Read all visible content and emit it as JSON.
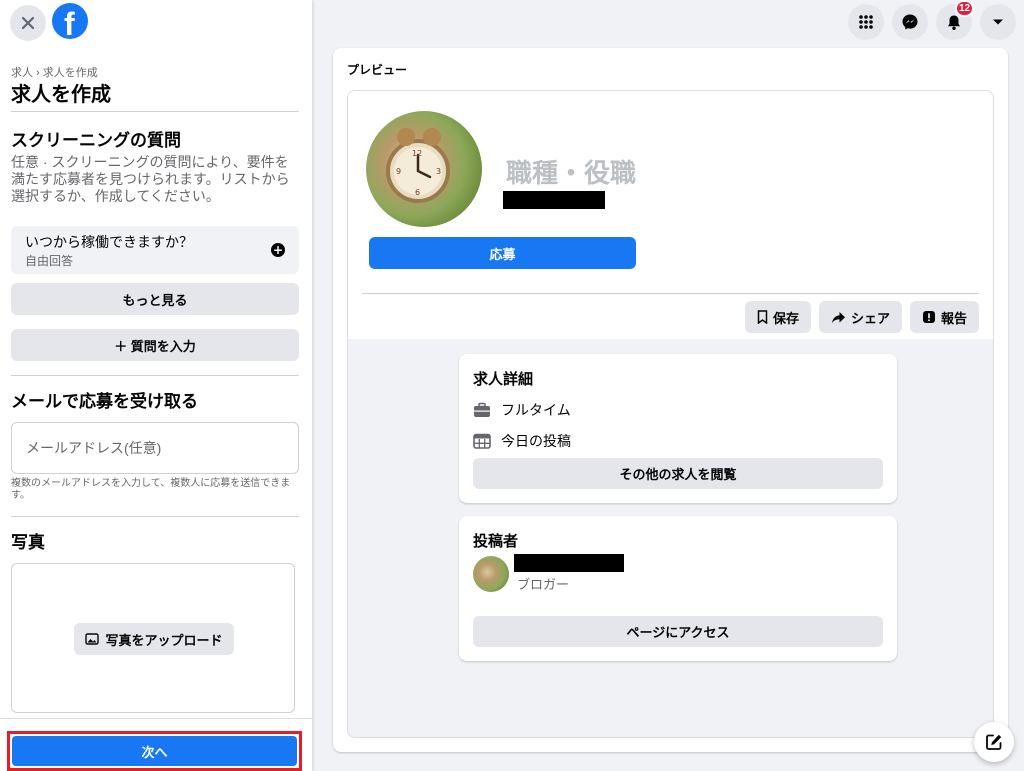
{
  "sidebar": {
    "breadcrumb": "求人 › 求人を作成",
    "title": "求人を作成",
    "screening": {
      "title": "スクリーニングの質問",
      "description": "任意 · スクリーニングの質問により、要件を満たす応募者を見つけられます。リストから選択するか、作成してください。",
      "question": "いつから稼働できますか？",
      "question_type": "自由回答",
      "see_more": "もっと見る",
      "add_question": "＋ 質問を入力"
    },
    "email": {
      "title": "メールで応募を受け取る",
      "placeholder": "メールアドレス(任意)",
      "hint": "複数のメールアドレスを入力して、複数人に応募を送信できます。"
    },
    "photo": {
      "title": "写真",
      "upload": "写真をアップロード"
    },
    "next_button": "次へ"
  },
  "topbar": {
    "notification_count": "12"
  },
  "preview": {
    "label": "プレビュー",
    "job_title": "職種・役職",
    "apply_button": "応募",
    "actions": {
      "save": "保存",
      "share": "シェア",
      "report": "報告"
    },
    "details": {
      "title": "求人詳細",
      "employment_type": "フルタイム",
      "posted": "今日の投稿",
      "browse_more": "その他の求人を閲覧"
    },
    "poster": {
      "title": "投稿者",
      "role": "ブロガー",
      "visit_page": "ページにアクセス"
    }
  },
  "colors": {
    "brand_blue": "#1877F2",
    "highlight_red": "#E41E26",
    "badge_red": "#E41E3F"
  },
  "icons": [
    "close-icon",
    "facebook-logo",
    "grid-menu-icon",
    "messenger-icon",
    "bell-icon",
    "caret-down-icon",
    "plus-circle-icon",
    "image-icon",
    "bookmark-icon",
    "share-arrow-icon",
    "report-icon",
    "briefcase-icon",
    "calendar-icon",
    "compose-icon"
  ]
}
